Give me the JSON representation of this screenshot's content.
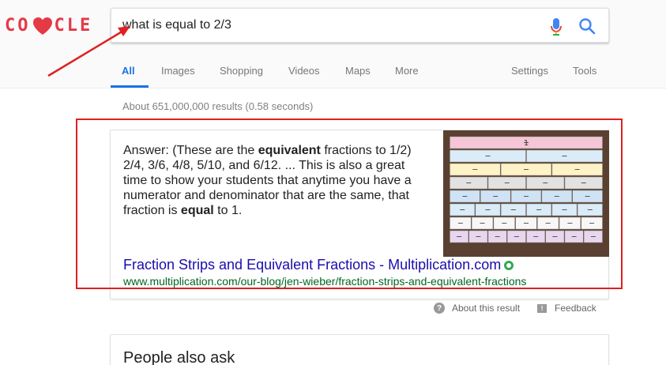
{
  "logo": {
    "text_left": "CO",
    "text_right": "CLE"
  },
  "search": {
    "query": "what is equal to 2/3"
  },
  "tabs": [
    {
      "label": "All"
    },
    {
      "label": "Images"
    },
    {
      "label": "Shopping"
    },
    {
      "label": "Videos"
    },
    {
      "label": "Maps"
    },
    {
      "label": "More"
    },
    {
      "label": "Settings"
    },
    {
      "label": "Tools"
    }
  ],
  "results": {
    "stats": "About 651,000,000 results (0.58 seconds)"
  },
  "featured": {
    "snippet_parts": [
      "Answer: (These are the ",
      "equivalent",
      " fractions to 1/2) 2/4, 3/6, 4/8, 5/10, and 6/12. ... This is also a great time to show your students that anytime you have a numerator and denominator that are the same, that fraction is ",
      "equal",
      " to 1."
    ],
    "title": "Fraction Strips and Equivalent Fractions - Multiplication.com",
    "url": "www.multiplication.com/our-blog/jen-wieber/fraction-strips-and-equivalent-fractions",
    "image_label": "1"
  },
  "feedback": {
    "about": "About this result",
    "feedback": "Feedback"
  },
  "people_also_ask": {
    "title": "People also ask"
  },
  "colors": {
    "accent": "#1a73e8",
    "link": "#1a0dab",
    "url": "#006621",
    "highlight": "#e02020",
    "logo": "#e53946"
  }
}
